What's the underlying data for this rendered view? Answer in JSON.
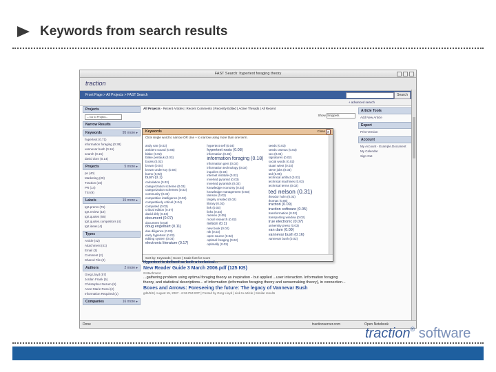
{
  "slide": {
    "title": "Keywords from search results",
    "logo_brand": "traction",
    "logo_reg": "®",
    "logo_suffix": " software"
  },
  "app": {
    "window_title": "FAST Search: hypertext foraging theory",
    "brand": "traction",
    "breadcrumb": "Front Page > All Projects > FAST Search",
    "search_button": "Search",
    "advanced_search": "+ advanced search",
    "projects_header": "Projects",
    "goto_project": "-- Go to Project--",
    "narrow_header": "Narrow Results",
    "main_crumb_bold": "All Projects",
    "main_crumb_rest": " - Recent Articles | Recent Comments | Recently Edited | Active Threads | All Recent",
    "show_label": "Show",
    "show_value": "Snippets",
    "status_done": "Done",
    "status_host": "tractionserver.com",
    "status_open": "Open Notebook"
  },
  "left_panels": [
    {
      "header": "Keywords",
      "more": "95 more",
      "items": [
        "hypertext (0.71)",
        "information foraging (0.38)",
        "vannevar bush (0.16)",
        "search (0.15)",
        "david dorn (0.14)"
      ]
    },
    {
      "header": "Projects",
      "more": "5 more",
      "items": [
        "pn (40)",
        "Marketing (20)",
        "Traction (16)",
        "PR (14)",
        "TSI (9)"
      ]
    },
    {
      "header": "Labels",
      "more": "15 more",
      "items": [
        "tgrt.prems (76)",
        "tgrt.review (18)",
        "tgrt.quotes (56)",
        "tgrt.quotes.competitors (4)",
        "tgrt.ideas (4)"
      ]
    },
    {
      "header": "Types",
      "more": "",
      "items": [
        "Article (42)",
        "Attachment (41)",
        "Email (3)",
        "Comment (2)",
        "Shared File (2)"
      ]
    },
    {
      "header": "Authors",
      "more": "2 more",
      "items": [
        "Greg Lloyd (57)",
        "Jordan Frank (5)",
        "Christopher Nuzum (5)",
        "Anne-Marie Rossi (2)",
        "Information Required (1)"
      ]
    },
    {
      "header": "Companies",
      "more": "16 more",
      "items": []
    }
  ],
  "right_panels": [
    {
      "header": "Article Tools",
      "items": [
        "Add New Article"
      ]
    },
    {
      "header": "Export",
      "items": [
        "Print Version"
      ]
    },
    {
      "header": "Account",
      "items": [
        "My Account - Example.Document",
        "My Calendar",
        "Sign Out"
      ]
    }
  ],
  "popup": {
    "header": "Keywords",
    "close_label": "Close",
    "hint": "Click single word to narrow OR Use + to narrow using more than one term.",
    "columns": [
      [
        "andy van (0.02)",
        "ambient sound (0.05)",
        "blake (0.02)",
        "blake pentauk (0.03)",
        "books (0.02)",
        "brown (0.04)",
        "brown under toy (0.04)",
        "bums (0.02)",
        "bush (0.1)",
        "calculation (0.02)",
        "categorization scheme (0.03)",
        "categorization schemes (0.02)",
        "community (0.02)",
        "competitive intelligence (0.03)",
        "competitively critical (0.04)",
        "computed (0.02)",
        "critical edition (0.07)",
        "david dirly (0.04)",
        "document (0.07)",
        "document (0.03)",
        "doug engelbart (0.11)",
        "due diligence (0.03)",
        "early hypertext (0.02)",
        "editing system (0.04)",
        "electronic literature (0.17)"
      ],
      [
        "hypertext self (0.04)",
        "hypertext roots (0.08)",
        "information (0.36)",
        "information foraging (0.18)",
        "information gent (0.02)",
        "information technology (0.02)",
        "inquiries (0.04)",
        "internet institute (0.02)",
        "inverted pyramid (0.03)",
        "inverted pyramids (0.02)",
        "knowledge economy (0.02)",
        "knowledge management (0.03)",
        "lamson (0.02)",
        "largely created (0.02)",
        "library (0.03)",
        "link (0.03)",
        "links (0.03)",
        "memex (0.05)",
        "moral research (0.02)",
        "nelson (0.1)",
        "new book (0.02)",
        "ntk (0.02)",
        "open source (0.02)",
        "optimal foraging (0.02)",
        "optimally (0.02)"
      ],
      [
        "seeds (0.03)",
        "seeds rasmus (0.03)",
        "seo (0.04)",
        "signatures (0.02)",
        "social words (0.02)",
        "stuart wiest (0.03)",
        "steve jobs (0.03)",
        "ted (0.05)",
        "technical artifact (0.03)",
        "technical machines (0.03)",
        "technical terms (0.02)",
        "ted nelson (0.31)",
        "theodor holm (0.02)",
        "thomas (0.05)",
        "traction (0.09)",
        "traction software (0.05)",
        "transformation (0.02)",
        "transporting window (0.02)",
        "true electronic (0.07)",
        "university press (0.03)",
        "van dam (0.09)",
        "vannevar bush (0.16)",
        "vannevar bush (0.02)"
      ]
    ],
    "big_terms": {
      "information foraging (0.18)": "big",
      "ted nelson (0.31)": "bigger",
      "hypertext roots (0.08)": "med",
      "document (0.07)": "med",
      "doug engelbart (0.11)": "med",
      "electronic literature (0.17)": "med",
      "bush (0.1)": "med",
      "nelson (0.1)": "med",
      "traction (0.09)": "med",
      "traction software (0.05)": "med",
      "true electronic (0.07)": "med",
      "van dam (0.09)": "med",
      "vannevar bush (0.16)": "med"
    },
    "footer": "Sort by: Keywords | Score | Scale font for score"
  },
  "results": [
    {
      "title": "New Reader Guide 3 March 2006.pdf (125 KB)",
      "text": "...gathering problem using optimal foraging theory as inspiration - but applied ...user interaction. Information foraging theory, and statistical descriptions... of information (information foraging theory and sensemaking theory), in connection...",
      "meta": "#Attachment"
    },
    {
      "title": "Boxes and Arrows: Foreseeing the future: The legacy of Vannevar Bush",
      "text": "",
      "meta": "gd1/5/9 | August 15, 2007 - 6:36 PM EDT | Posted by Greg Lloyd | Link to article | Similar results"
    }
  ],
  "hypertext_line": "Hypertext is defined as both a technical..."
}
